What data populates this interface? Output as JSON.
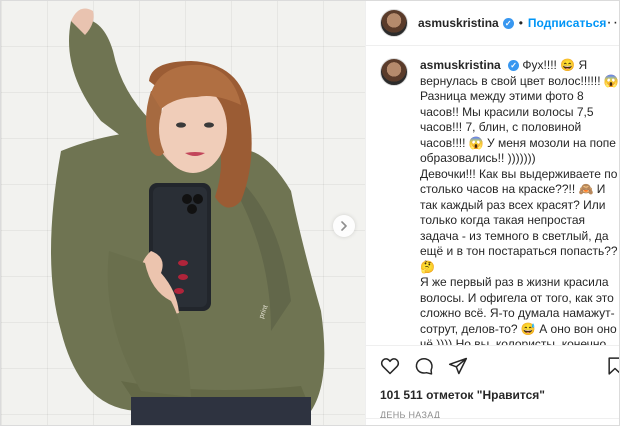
{
  "post": {
    "username": "asmuskristina",
    "follow_label": "Подписаться",
    "separator": "•",
    "caption_user": "asmuskristina",
    "caption": "Фух!!!! 😄 Я вернулась в свой цвет волос!!!!!! 😱 Разница между этими фото 8 часов!! Мы красили волосы 7,5 часов!!! 7, блин, с половиной часов!!!! 😱 У меня мозоли на попе образовались!! )))))))\nДевочки!!! Как вы выдерживаете по столько часов на краске??!! 🙈 И так каждый раз всех красят? Или только когда такая непростая задача - из темного в светлый, да ещё и в тон постараться попасть?? 🤔\nЯ же первый раз в жизни красила волосы. И офигела от того, как это сложно всё. Я-то думала намажут-сотрут, делов-то? 😅 А оно вон оно чё )))) Но вы, колористы, конечно, волшебники!!! 🙇 Особенно моя",
    "likes_count": "101 511",
    "likes_label": "отметок \"Нравится\"",
    "time": "ДЕНЬ НАЗАД"
  },
  "icons": {
    "like": "heart-icon",
    "comment": "comment-icon",
    "share": "share-icon",
    "save": "bookmark-icon",
    "more": "more-dots-icon",
    "next": "chevron-right-icon",
    "verified": "verified-badge-icon"
  },
  "colors": {
    "link": "#0095f6",
    "verified": "#3897f0",
    "hoodie": "#6f7452",
    "hair": "#a0623a"
  }
}
